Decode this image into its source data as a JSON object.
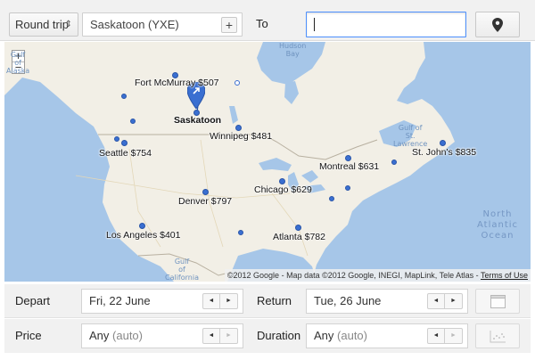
{
  "topbar": {
    "trip_type": "Round trip",
    "origin": "Saskatoon (YXE)",
    "add_label": "+",
    "to_label": "To",
    "destination_value": "",
    "icons": {
      "trip_type_arrow": "up-down-arrows-icon",
      "map_pin": "map-pin-icon"
    }
  },
  "map": {
    "zoom_in": "+",
    "zoom_out": "−",
    "cities": [
      {
        "name": "Fort McMurray",
        "price": "$507"
      },
      {
        "name": "Saskatoon",
        "price": ""
      },
      {
        "name": "Winnipeg",
        "price": "$481"
      },
      {
        "name": "Seattle",
        "price": "$754"
      },
      {
        "name": "Montreal",
        "price": "$631"
      },
      {
        "name": "St. John's",
        "price": "$835"
      },
      {
        "name": "Chicago",
        "price": "$629"
      },
      {
        "name": "Denver",
        "price": "$797"
      },
      {
        "name": "Los Angeles",
        "price": "$401"
      },
      {
        "name": "Atlanta",
        "price": "$782"
      }
    ],
    "labels": {
      "city_0": "Fort McMurray $507",
      "city_1": "Saskatoon",
      "city_2": "Winnipeg $481",
      "city_3": "Seattle $754",
      "city_4": "Montreal $631",
      "city_5": "St. John's $835",
      "city_6": "Chicago $629",
      "city_7": "Denver $797",
      "city_8": "Los Angeles $401",
      "city_9": "Atlanta $782"
    },
    "water": {
      "hudson": "Hudson\nBay",
      "gulf_alaska": "Gulf\nof\nAlaska",
      "gulf_st_lawrence": "Gulf of\nSt.\nLawrence",
      "north_atlantic": "North\nAtlantic\nOcean",
      "gulf_california": "Gulf\nof\nCalifornia"
    },
    "attribution": "©2012 Google - Map data ©2012 Google, INEGI, MapLink, Tele Atlas - ",
    "terms_link": "Terms of Use"
  },
  "dates": {
    "depart_label": "Depart",
    "depart_value": "Fri, 22 June",
    "return_label": "Return",
    "return_value": "Tue, 26 June",
    "stepper_prev": "◄",
    "stepper_next": "►",
    "calendar_icon": "calendar-icon"
  },
  "filters": {
    "price_label": "Price",
    "price_value": "Any",
    "price_hint": "(auto)",
    "duration_label": "Duration",
    "duration_value": "Any",
    "duration_hint": "(auto)",
    "scatter_icon": "scatter-plot-icon"
  },
  "colors": {
    "accent_blue": "#3a6fd1",
    "focus_border": "#4d90fe",
    "ocean": "#a6c6e8",
    "land": "#f2efe6"
  }
}
